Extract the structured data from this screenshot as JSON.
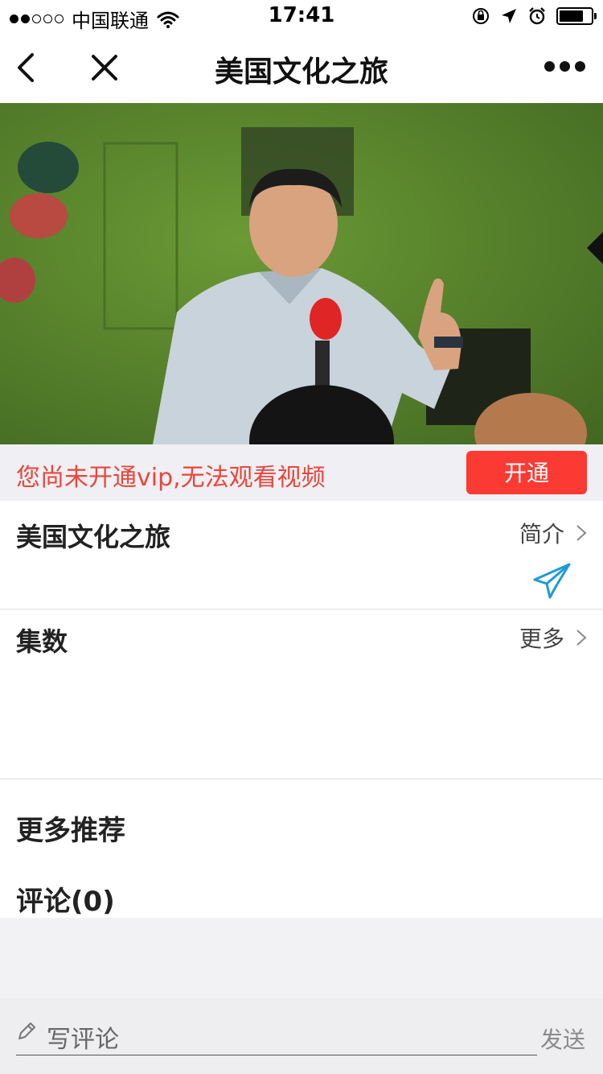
{
  "status_bar": {
    "carrier": "中国联通",
    "time": "17:41",
    "battery_level": 0.75
  },
  "nav": {
    "title": "美国文化之旅"
  },
  "vip": {
    "notice": "您尚未开通vip,无法观看视频",
    "button_label": "开通",
    "button_color": "#fb3a33",
    "notice_color": "#e8473b"
  },
  "course": {
    "title": "美国文化之旅",
    "intro_link": "简介"
  },
  "episodes": {
    "title": "集数",
    "more_link": "更多"
  },
  "recommend": {
    "title": "更多推荐"
  },
  "comments": {
    "title": "评论(0)",
    "input_placeholder": "写评论",
    "send_label": "发送"
  },
  "icons": {
    "back": "chevron-left-icon",
    "close": "close-icon",
    "more": "more-dots-icon",
    "share": "paper-plane-icon",
    "pencil": "pencil-icon"
  }
}
